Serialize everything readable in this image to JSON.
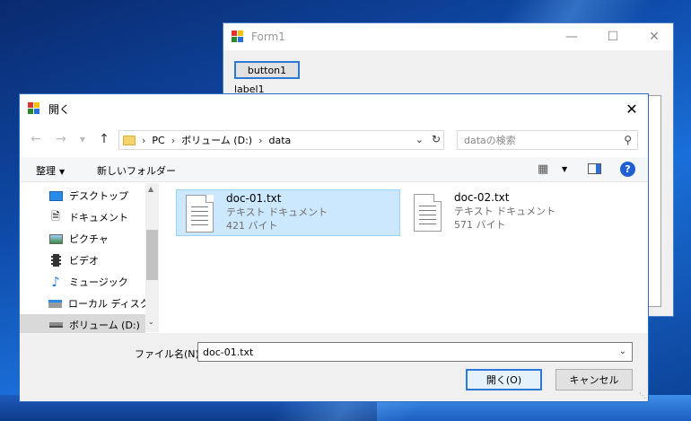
{
  "form1": {
    "title": "Form1",
    "button1_label": "button1",
    "label1_text": "label1"
  },
  "dialog": {
    "title": "開く",
    "address": {
      "crumbs": [
        "PC",
        "ボリューム (D:)",
        "data"
      ]
    },
    "search_placeholder": "dataの検索",
    "toolbar": {
      "organize": "整理",
      "new_folder": "新しいフォルダー"
    },
    "nav_items": [
      {
        "label": "デスクトップ",
        "icon": "desktop-icon"
      },
      {
        "label": "ドキュメント",
        "icon": "documents-icon"
      },
      {
        "label": "ピクチャ",
        "icon": "pictures-icon"
      },
      {
        "label": "ビデオ",
        "icon": "videos-icon"
      },
      {
        "label": "ミュージック",
        "icon": "music-icon"
      },
      {
        "label": "ローカル ディスク (C",
        "icon": "local-disk-icon"
      },
      {
        "label": "ボリューム (D:)",
        "icon": "drive-icon"
      }
    ],
    "files": [
      {
        "name": "doc-01.txt",
        "type": "テキスト ドキュメント",
        "size": "421 バイト",
        "selected": true
      },
      {
        "name": "doc-02.txt",
        "type": "テキスト ドキュメント",
        "size": "571 バイト",
        "selected": false
      }
    ],
    "filename_label": "ファイル名(N):",
    "filename_value": "doc-01.txt",
    "open_label": "開く(O)",
    "cancel_label": "キャンセル"
  },
  "colors": {
    "accent": "#2d7ad6",
    "selection": "#cce8ff",
    "help": "#1f5fcf"
  }
}
